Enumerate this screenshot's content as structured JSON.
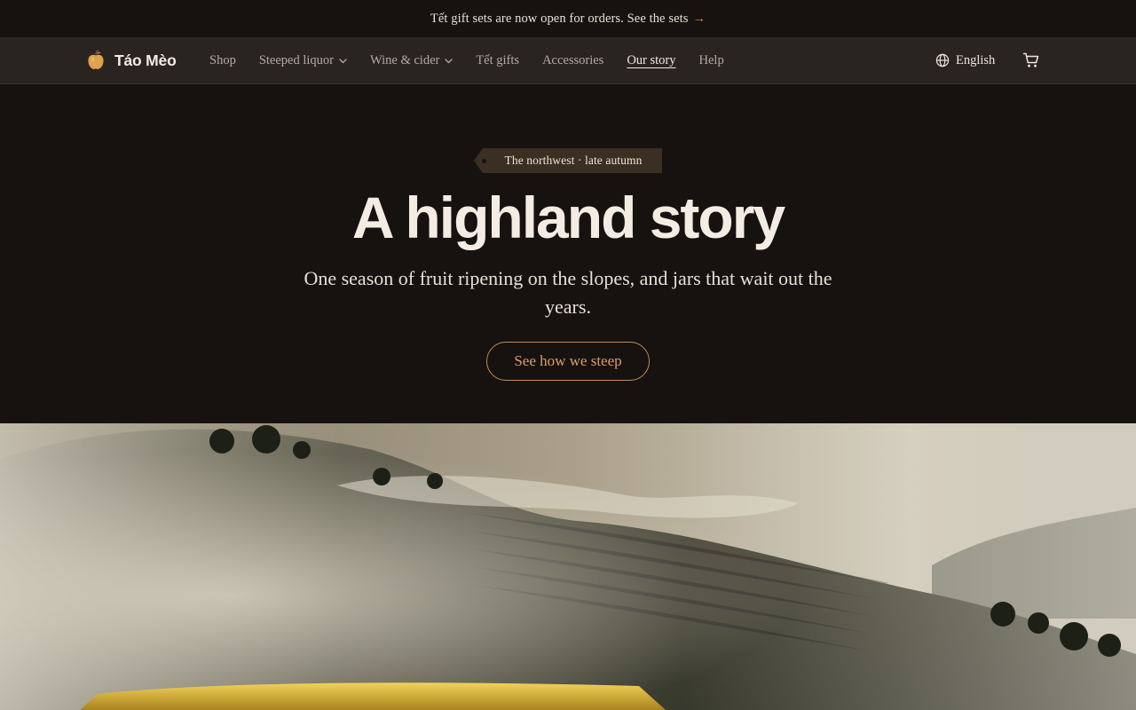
{
  "announcement": {
    "text": "Tết gift sets are now open for orders. See the sets",
    "arrow": "→"
  },
  "brand": {
    "name": "Táo Mèo",
    "logo_icon": "apple-fruit-icon",
    "logo_color": "#e0a24f"
  },
  "nav": {
    "items": [
      {
        "label": "Shop",
        "has_dropdown": false,
        "active": false
      },
      {
        "label": "Steeped liquor",
        "has_dropdown": true,
        "active": false
      },
      {
        "label": "Wine & cider",
        "has_dropdown": true,
        "active": false
      },
      {
        "label": "Tết gifts",
        "has_dropdown": false,
        "active": false
      },
      {
        "label": "Accessories",
        "has_dropdown": false,
        "active": false
      },
      {
        "label": "Our story",
        "has_dropdown": false,
        "active": true
      },
      {
        "label": "Help",
        "has_dropdown": false,
        "active": false
      }
    ],
    "language": "English",
    "language_icon": "globe-icon",
    "cart_icon": "cart-icon"
  },
  "hero": {
    "tag": "The northwest · late autumn",
    "title": "A highland story",
    "subtitle": "One season of fruit ripening on the slopes, and jars that wait out the years.",
    "cta_label": "See how we steep"
  },
  "colors": {
    "background": "#161210",
    "nav_background": "#2a2421",
    "accent": "#d8904c",
    "text_primary": "#f3ece3"
  }
}
